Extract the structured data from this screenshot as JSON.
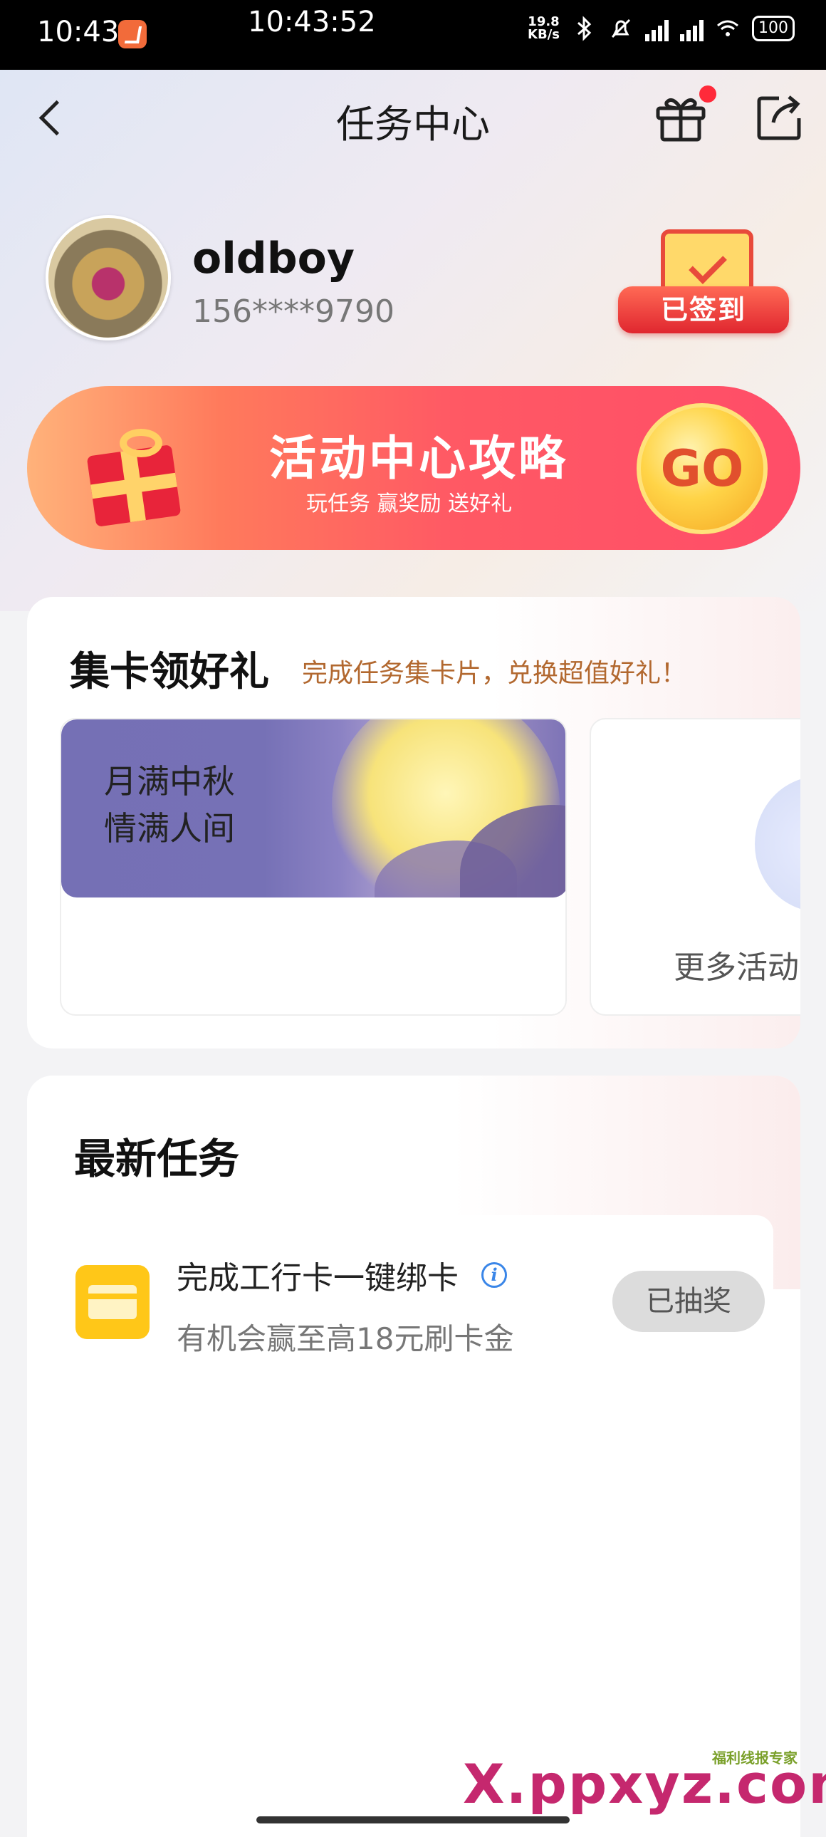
{
  "status_bar": {
    "time": "10:43",
    "clock": "10:43:52",
    "speed_value": "19.8",
    "speed_unit": "KB/s",
    "battery": "100"
  },
  "header": {
    "title": "任务中心"
  },
  "profile": {
    "username": "oldboy",
    "phone": "156****9790",
    "sign_status": "已签到"
  },
  "banner": {
    "title": "活动中心攻略",
    "subtitle": "玩任务 赢奖励 送好礼",
    "go_label": "GO"
  },
  "cards": {
    "title": "集卡领好礼",
    "subtitle": "完成任务集卡片，兑换超值好礼！",
    "items": [
      {
        "label": "月满中秋\n情满人间"
      },
      {
        "label": "更多活动"
      }
    ]
  },
  "tasks": {
    "title": "最新任务",
    "items": [
      {
        "title": "完成工行卡一键绑卡",
        "desc": "有机会赢至高18元刷卡金",
        "button": "已抽奖",
        "icon": "bank-card-icon"
      }
    ]
  },
  "watermark": {
    "text": "X.ppxyz.com",
    "small": "福利线报专家"
  }
}
